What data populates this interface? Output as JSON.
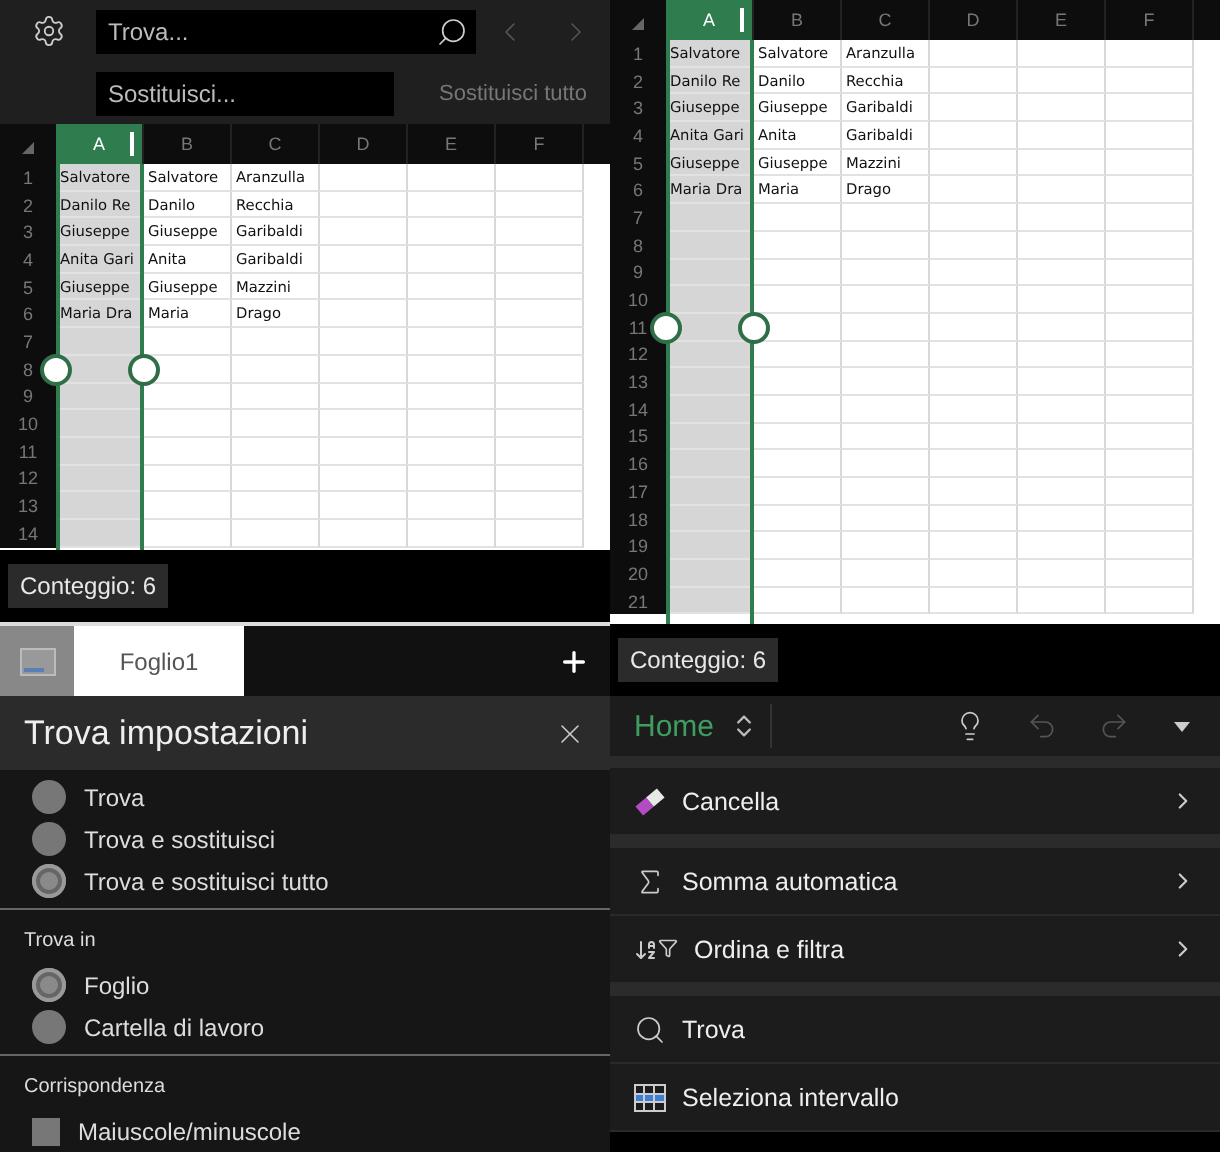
{
  "find_bar": {
    "find_placeholder": "Trova...",
    "replace_placeholder": "Sostituisci...",
    "prev_disabled": true,
    "next_disabled": true,
    "replace_all": {
      "label": "Sostituisci tutto",
      "disabled": true
    }
  },
  "left_sheet": {
    "columns": [
      {
        "label": "A",
        "selected": true
      },
      {
        "label": "B",
        "selected": false
      },
      {
        "label": "C",
        "selected": false
      },
      {
        "label": "D",
        "selected": false
      },
      {
        "label": "E",
        "selected": false
      },
      {
        "label": "F",
        "selected": false
      }
    ],
    "row_numbers": [
      "1",
      "2",
      "3",
      "4",
      "5",
      "6",
      "7",
      "8",
      "9",
      "10",
      "11",
      "12",
      "13",
      "14"
    ],
    "rows": [
      [
        "Salvatore",
        "Salvatore",
        "Aranzulla"
      ],
      [
        "Danilo Re",
        "Danilo",
        "Recchia"
      ],
      [
        "Giuseppe",
        "Giuseppe",
        "Garibaldi"
      ],
      [
        "Anita Gari",
        "Anita",
        "Garibaldi"
      ],
      [
        "Giuseppe",
        "Giuseppe",
        "Mazzini"
      ],
      [
        "Maria Dra",
        "Maria",
        "Drago"
      ]
    ],
    "status": "Conteggio: 6"
  },
  "sheet_tabs": [
    {
      "label": "Foglio1",
      "selected": true
    }
  ],
  "find_settings": {
    "title": "Trova impostazioni",
    "sections": [
      {
        "kind": "radio",
        "options": [
          {
            "label": "Trova",
            "selected": false
          },
          {
            "label": "Trova e sostituisci",
            "selected": false
          },
          {
            "label": "Trova e sostituisci tutto",
            "selected": true
          }
        ]
      },
      {
        "kind": "radio",
        "title": "Trova in",
        "options": [
          {
            "label": "Foglio",
            "selected": true
          },
          {
            "label": "Cartella di lavoro",
            "selected": false
          }
        ]
      },
      {
        "kind": "checkbox",
        "title": "Corrispondenza",
        "options": [
          {
            "label": "Maiuscole/minuscole",
            "checked": false
          }
        ]
      }
    ]
  },
  "right_sheet": {
    "columns": [
      {
        "label": "A",
        "selected": true
      },
      {
        "label": "B",
        "selected": false
      },
      {
        "label": "C",
        "selected": false
      },
      {
        "label": "D",
        "selected": false
      },
      {
        "label": "E",
        "selected": false
      },
      {
        "label": "F",
        "selected": false
      }
    ],
    "row_numbers": [
      "1",
      "2",
      "3",
      "4",
      "5",
      "6",
      "7",
      "8",
      "9",
      "10",
      "11",
      "12",
      "13",
      "14",
      "15",
      "16",
      "17",
      "18",
      "19",
      "20",
      "21"
    ],
    "rows": [
      [
        "Salvatore",
        "Salvatore",
        "Aranzulla"
      ],
      [
        "Danilo Re",
        "Danilo",
        "Recchia"
      ],
      [
        "Giuseppe",
        "Giuseppe",
        "Garibaldi"
      ],
      [
        "Anita Gari",
        "Anita",
        "Garibaldi"
      ],
      [
        "Giuseppe",
        "Giuseppe",
        "Mazzini"
      ],
      [
        "Maria Dra",
        "Maria",
        "Drago"
      ]
    ],
    "status": "Conteggio: 6"
  },
  "ribbon": {
    "tab": "Home",
    "undo_disabled": true,
    "redo_disabled": true,
    "groups": [
      [
        {
          "kind": "eraser",
          "label": "Cancella",
          "submenu": true
        }
      ],
      [
        {
          "kind": "sum",
          "label": "Somma automatica",
          "submenu": true
        },
        {
          "kind": "sort",
          "label": "Ordina e filtra",
          "submenu": true
        }
      ],
      [
        {
          "kind": "search",
          "label": "Trova",
          "submenu": false
        },
        {
          "kind": "range",
          "label": "Seleziona intervallo",
          "submenu": false
        }
      ]
    ]
  }
}
